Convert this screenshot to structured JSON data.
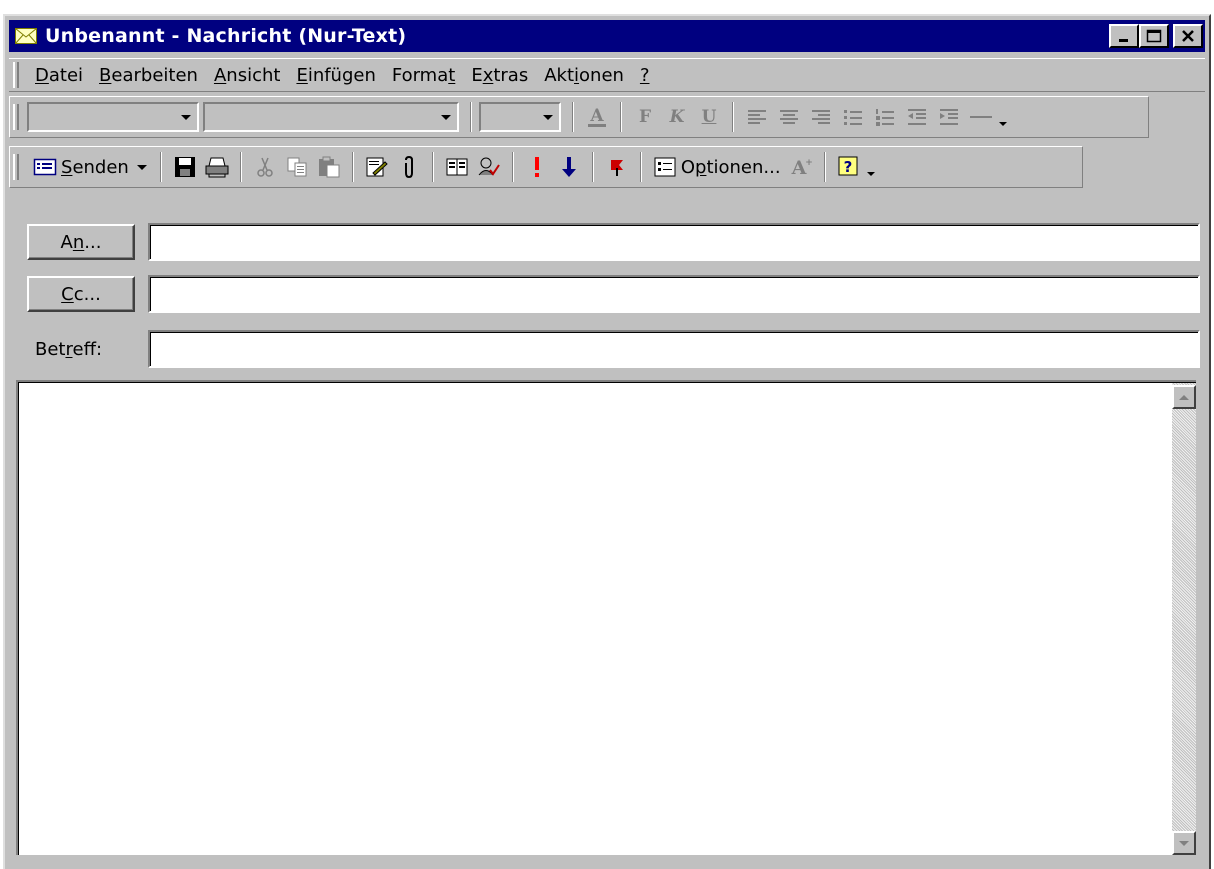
{
  "window": {
    "title": "Unbenannt - Nachricht (Nur-Text)"
  },
  "menu": [
    {
      "pre": "",
      "key": "D",
      "post": "atei"
    },
    {
      "pre": "",
      "key": "B",
      "post": "earbeiten"
    },
    {
      "pre": "",
      "key": "A",
      "post": "nsicht"
    },
    {
      "pre": "",
      "key": "E",
      "post": "infügen"
    },
    {
      "pre": "Forma",
      "key": "t",
      "post": ""
    },
    {
      "pre": "E",
      "key": "x",
      "post": "tras"
    },
    {
      "pre": "Akt",
      "key": "i",
      "post": "onen"
    },
    {
      "pre": "",
      "key": "?",
      "post": ""
    }
  ],
  "formatting_toolbar": {
    "font_name": "",
    "font_style": "",
    "font_size": "",
    "bold_glyph": "F",
    "italic_glyph": "K",
    "underline_glyph": "U"
  },
  "standard_toolbar": {
    "send": {
      "key": "S",
      "rest": "enden"
    },
    "options": {
      "pre": "O",
      "key": "p",
      "rest": "tionen..."
    }
  },
  "address": {
    "to_button": {
      "pre": "A",
      "key": "n",
      "rest": "..."
    },
    "cc_button": {
      "pre": "",
      "key": "C",
      "rest": "c..."
    },
    "subject_label": {
      "pre": "Bet",
      "key": "r",
      "rest": "eff:"
    },
    "to_value": "",
    "cc_value": "",
    "subject_value": ""
  },
  "body_text": "",
  "colors": {
    "titlebar": "#000080",
    "face": "#c0c0c0",
    "importance_high": "#ff0000",
    "importance_low": "#000080",
    "flag": "#cc0000"
  },
  "icons": [
    "envelope-icon",
    "minimize-icon",
    "maximize-icon",
    "close-icon",
    "send-icon",
    "save-icon",
    "print-icon",
    "cut-icon",
    "copy-icon",
    "paste-icon",
    "signature-icon",
    "attach-icon",
    "address-book-icon",
    "check-names-icon",
    "high-importance-icon",
    "low-importance-icon",
    "flag-icon",
    "options-icon",
    "font-color-icon",
    "help-icon"
  ]
}
